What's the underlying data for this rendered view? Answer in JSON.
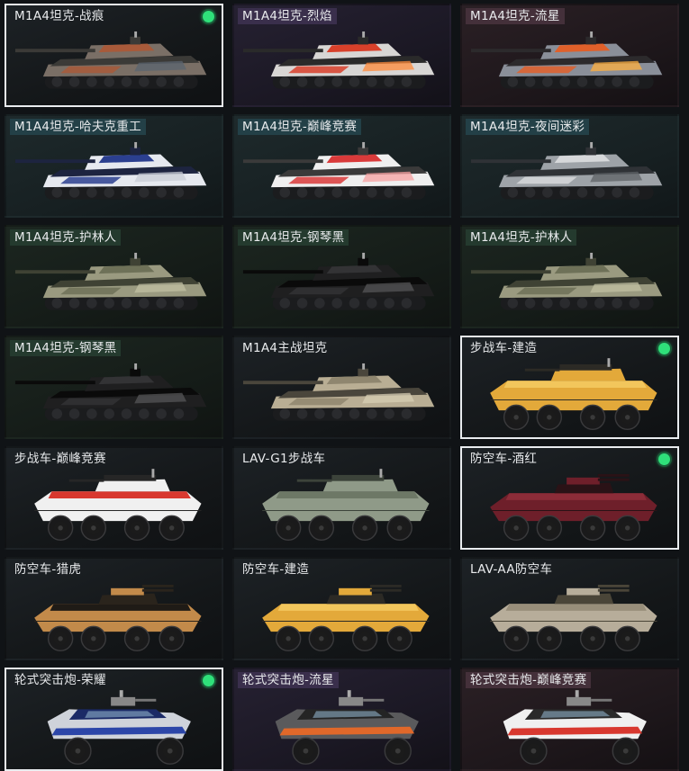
{
  "items": [
    {
      "label": "M1A4坦克-战痕",
      "type": "tank",
      "palette": [
        "#7a6f66",
        "#3b3a37",
        "#a85a3a",
        "#5b6470"
      ],
      "selected": true,
      "equipped": true,
      "tag": "bg-none",
      "theme": "t-dark"
    },
    {
      "label": "M1A4坦克-烈焰",
      "type": "tank",
      "palette": [
        "#d8d6d4",
        "#2a2a2a",
        "#d8402a",
        "#ff8a3a"
      ],
      "selected": false,
      "equipped": false,
      "tag": "bg-purple",
      "theme": "t-purple"
    },
    {
      "label": "M1A4坦克-流星",
      "type": "tank",
      "palette": [
        "#8a8f99",
        "#2c2a2c",
        "#e0602a",
        "#ffb040"
      ],
      "selected": false,
      "equipped": false,
      "tag": "bg-rose",
      "theme": "t-rose"
    },
    {
      "label": "M1A4坦克-哈夫克重工",
      "type": "tank",
      "palette": [
        "#e6e9ef",
        "#1d2440",
        "#2b3f8f",
        "#c8ccd6"
      ],
      "selected": false,
      "equipped": false,
      "tag": "bg-teal",
      "theme": "t-teal"
    },
    {
      "label": "M1A4坦克-巅峰竞赛",
      "type": "tank",
      "palette": [
        "#efefef",
        "#3a3a3a",
        "#d93a3a",
        "#f5a0a0"
      ],
      "selected": false,
      "equipped": false,
      "tag": "bg-teal",
      "theme": "t-teal"
    },
    {
      "label": "M1A4坦克-夜间迷彩",
      "type": "tank",
      "palette": [
        "#9ea3a8",
        "#2f3236",
        "#d6d8da",
        "#5e6266"
      ],
      "selected": false,
      "equipped": false,
      "tag": "bg-teal",
      "theme": "t-teal"
    },
    {
      "label": "M1A4坦克-护林人",
      "type": "tank",
      "palette": [
        "#9a9a80",
        "#3f4234",
        "#6e7158",
        "#c0bfa2"
      ],
      "selected": false,
      "equipped": false,
      "tag": "bg-green",
      "theme": "t-green"
    },
    {
      "label": "M1A4坦克-钢琴黑",
      "type": "tank",
      "palette": [
        "#1f1f20",
        "#0a0a0a",
        "#333335",
        "#555557"
      ],
      "selected": false,
      "equipped": false,
      "tag": "bg-green",
      "theme": "t-green"
    },
    {
      "label": "M1A4坦克-护林人",
      "type": "tank",
      "palette": [
        "#9a9a80",
        "#3f4234",
        "#6e7158",
        "#c0bfa2"
      ],
      "selected": false,
      "equipped": false,
      "tag": "bg-green",
      "theme": "t-green"
    },
    {
      "label": "M1A4坦克-钢琴黑",
      "type": "tank",
      "palette": [
        "#1f1f20",
        "#0a0a0a",
        "#333335",
        "#555557"
      ],
      "selected": false,
      "equipped": false,
      "tag": "bg-green",
      "theme": "t-green"
    },
    {
      "label": "M1A4主战坦克",
      "type": "tank",
      "palette": [
        "#b9ae94",
        "#4a463c",
        "#8f866f",
        "#d7cdb3"
      ],
      "selected": false,
      "equipped": false,
      "tag": "bg-none",
      "theme": "t-dark"
    },
    {
      "label": "步战车-建造",
      "type": "ifv",
      "palette": [
        "#e3a93a",
        "#2c2a25",
        "#f2c65c",
        "#1b1b1b"
      ],
      "selected": true,
      "equipped": true,
      "tag": "bg-none",
      "theme": "t-dark"
    },
    {
      "label": "步战车-巅峰竞赛",
      "type": "ifv",
      "palette": [
        "#f0f0f0",
        "#262626",
        "#d8382f",
        "#1b1b1b"
      ],
      "selected": false,
      "equipped": false,
      "tag": "bg-none",
      "theme": "t-dark"
    },
    {
      "label": "LAV-G1步战车",
      "type": "ifv",
      "palette": [
        "#8f9a88",
        "#3c433a",
        "#6d7866",
        "#1b1b1b"
      ],
      "selected": false,
      "equipped": false,
      "tag": "bg-none",
      "theme": "t-dark"
    },
    {
      "label": "防空车-酒红",
      "type": "aa",
      "palette": [
        "#6e1f2a",
        "#2a1216",
        "#8c2c38",
        "#1b1b1b"
      ],
      "selected": true,
      "equipped": true,
      "tag": "bg-none",
      "theme": "t-dark"
    },
    {
      "label": "防空车-猎虎",
      "type": "aa",
      "palette": [
        "#c28a4a",
        "#2a241c",
        "#1f1b16",
        "#1b1b1b"
      ],
      "selected": false,
      "equipped": false,
      "tag": "bg-none",
      "theme": "t-dark"
    },
    {
      "label": "防空车-建造",
      "type": "aa",
      "palette": [
        "#e3a93a",
        "#2c2a25",
        "#f2c65c",
        "#1b1b1b"
      ],
      "selected": false,
      "equipped": false,
      "tag": "bg-none",
      "theme": "t-dark"
    },
    {
      "label": "LAV-AA防空车",
      "type": "aa",
      "palette": [
        "#b7ad9a",
        "#4a4538",
        "#988e7a",
        "#1b1b1b"
      ],
      "selected": false,
      "equipped": false,
      "tag": "bg-none",
      "theme": "t-dark"
    },
    {
      "label": "轮式突击炮-荣耀",
      "type": "buggy",
      "palette": [
        "#cfd3da",
        "#1b2a66",
        "#2c46a8",
        "#1b1b1b"
      ],
      "selected": true,
      "equipped": true,
      "tag": "bg-none",
      "theme": "t-dark"
    },
    {
      "label": "轮式突击炮-流星",
      "type": "buggy",
      "palette": [
        "#5a5a5c",
        "#242424",
        "#e0682a",
        "#1b1b1b"
      ],
      "selected": false,
      "equipped": false,
      "tag": "bg-purple",
      "theme": "t-purple"
    },
    {
      "label": "轮式突击炮-巅峰竞赛",
      "type": "buggy",
      "palette": [
        "#f0f0f0",
        "#2a2a2a",
        "#d8382f",
        "#1b1b1b"
      ],
      "selected": false,
      "equipped": false,
      "tag": "bg-rose",
      "theme": "t-rose"
    }
  ]
}
